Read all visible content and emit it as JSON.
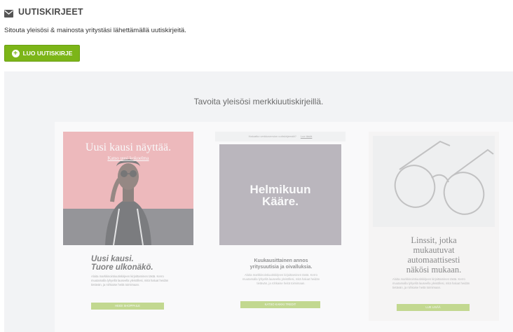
{
  "header": {
    "title": "UUTISKIRJEET",
    "icon": "envelope-icon"
  },
  "subtitle": "Sitouta yleisösi & mainosta yritystäsi lähettämällä uutiskirjeitä.",
  "create_button": {
    "label": "LUO UUTISKIRJE",
    "icon": "plus-circle-icon",
    "color": "#7cb518"
  },
  "panel": {
    "title": "Tavoita yleisösi merkkiuutiskirjeillä."
  },
  "cards": [
    {
      "hero_headline": "Uusi kausi näyttää.",
      "hero_link": "Katso uusi kokoelma",
      "title_line1": "Uusi kausi.",
      "title_line2": "Tuore ulkonäkö.",
      "body": "Aloita markkinointiuutiskirjeen kirjoittaminen tästä. Kerro muutamalla lyhyellä lauseella yleisöllesi, mitä haluat heidän tietävän, ja rohkaise heitä toimimaan.",
      "button_label": "HEIDI SHOPPAILE",
      "hero_color": "#e98a8f"
    },
    {
      "top_text": "Haluatko verkkoversion uutiskirjeestä?",
      "top_link": "Lue tästä",
      "hero_line1": "Helmikuun",
      "hero_line2": "Kääre.",
      "title_line1": "Kuukausittainen annos",
      "title_line2": "yritysuutisia ja oivalluksia.",
      "body": "Aloita markkinointiuutiskirjeen kirjoittaminen tästä. Kerro muutamalla lyhyellä lauseella yleisöllesi, mitä haluat heidän tietävän, ja rohkaise heitä toimimaan.",
      "button_label": "KATSO KAIKKI TREDIT",
      "hero_color": "#8d8690"
    },
    {
      "title_line1": "Linssit, jotka",
      "title_line2": "mukautuvat",
      "title_line3": "automaattisesti",
      "title_line4": "näkösi mukaan.",
      "body": "Aloita markkinointiuutiskirjeen kirjoittaminen tästä. Kerro muutamalla lyhyellä lauseella yleisöllesi, mitä haluat heidän tietävän, ja rohkaise heitä toimimaan.",
      "button_label": "LUE LISÄÄ"
    }
  ]
}
